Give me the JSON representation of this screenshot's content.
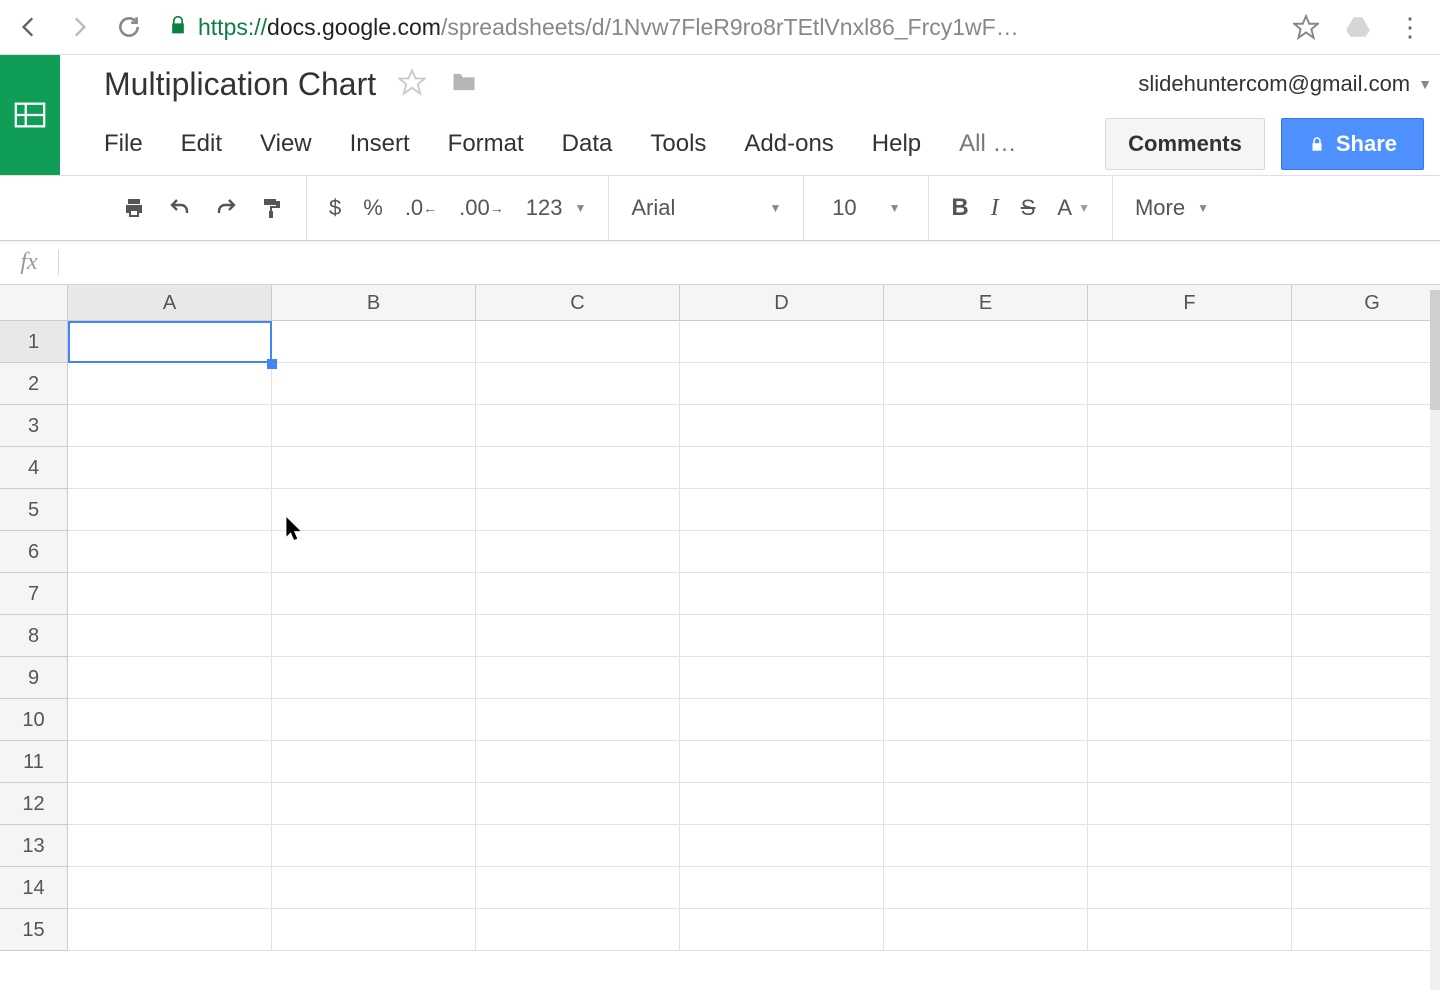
{
  "browser": {
    "url_scheme": "https://",
    "url_host": "docs.google.com",
    "url_path": "/spreadsheets/d/1Nvw7FleR9ro8rTEtlVnxl86_Frcy1wF…"
  },
  "app": {
    "document_title": "Multiplication Chart",
    "user_email": "slidehuntercom@gmail.com",
    "menu": [
      "File",
      "Edit",
      "View",
      "Insert",
      "Format",
      "Data",
      "Tools",
      "Add-ons",
      "Help"
    ],
    "menu_more": "All …",
    "comments_label": "Comments",
    "share_label": "Share"
  },
  "toolbar": {
    "currency": "$",
    "percent": "%",
    "dec_dec": ".0",
    "dec_inc": ".00",
    "number_format": "123",
    "font_name": "Arial",
    "font_size": "10",
    "bold": "B",
    "italic": "I",
    "strike": "S",
    "text_color": "A",
    "more": "More"
  },
  "fx_label": "fx",
  "grid": {
    "columns": [
      "A",
      "B",
      "C",
      "D",
      "E",
      "F",
      "G"
    ],
    "rows": [
      "1",
      "2",
      "3",
      "4",
      "5",
      "6",
      "7",
      "8",
      "9",
      "10",
      "11",
      "12",
      "13",
      "14",
      "15"
    ],
    "selected_col": "A",
    "selected_row": "1",
    "cells": {}
  }
}
